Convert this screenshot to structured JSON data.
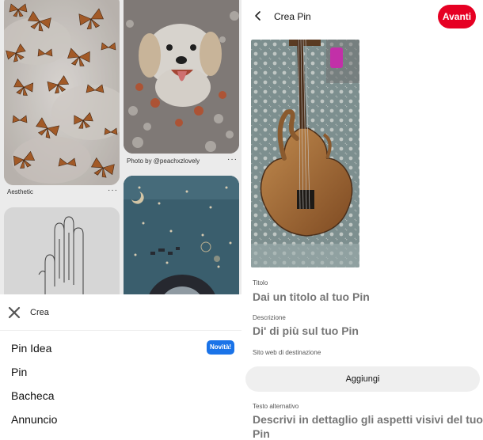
{
  "left": {
    "cards": [
      {
        "caption": "Aesthetic",
        "menu": "···"
      },
      {
        "caption": "Photo by @peachxzlovely",
        "menu": "···"
      }
    ],
    "sheet": {
      "title": "Crea",
      "items": [
        {
          "label": "Pin Idea",
          "badge": "Novità!"
        },
        {
          "label": "Pin"
        },
        {
          "label": "Bacheca"
        },
        {
          "label": "Annuncio"
        }
      ]
    }
  },
  "right": {
    "header": {
      "title": "Crea Pin",
      "next_label": "Avanti"
    },
    "form": {
      "title_label": "Titolo",
      "title_placeholder": "Dai un titolo al tuo Pin",
      "description_label": "Descrizione",
      "description_placeholder": "Di' di più sul tuo Pin",
      "website_label": "Sito web di destinazione",
      "add_button": "Aggiungi",
      "alt_label": "Testo alternativo",
      "alt_placeholder_line1": "Descrivi in dettaglio gli aspetti visivi del tuo",
      "alt_placeholder_line2": "Pin"
    }
  },
  "colors": {
    "accent": "#e60023",
    "badge": "#1a73e8"
  }
}
